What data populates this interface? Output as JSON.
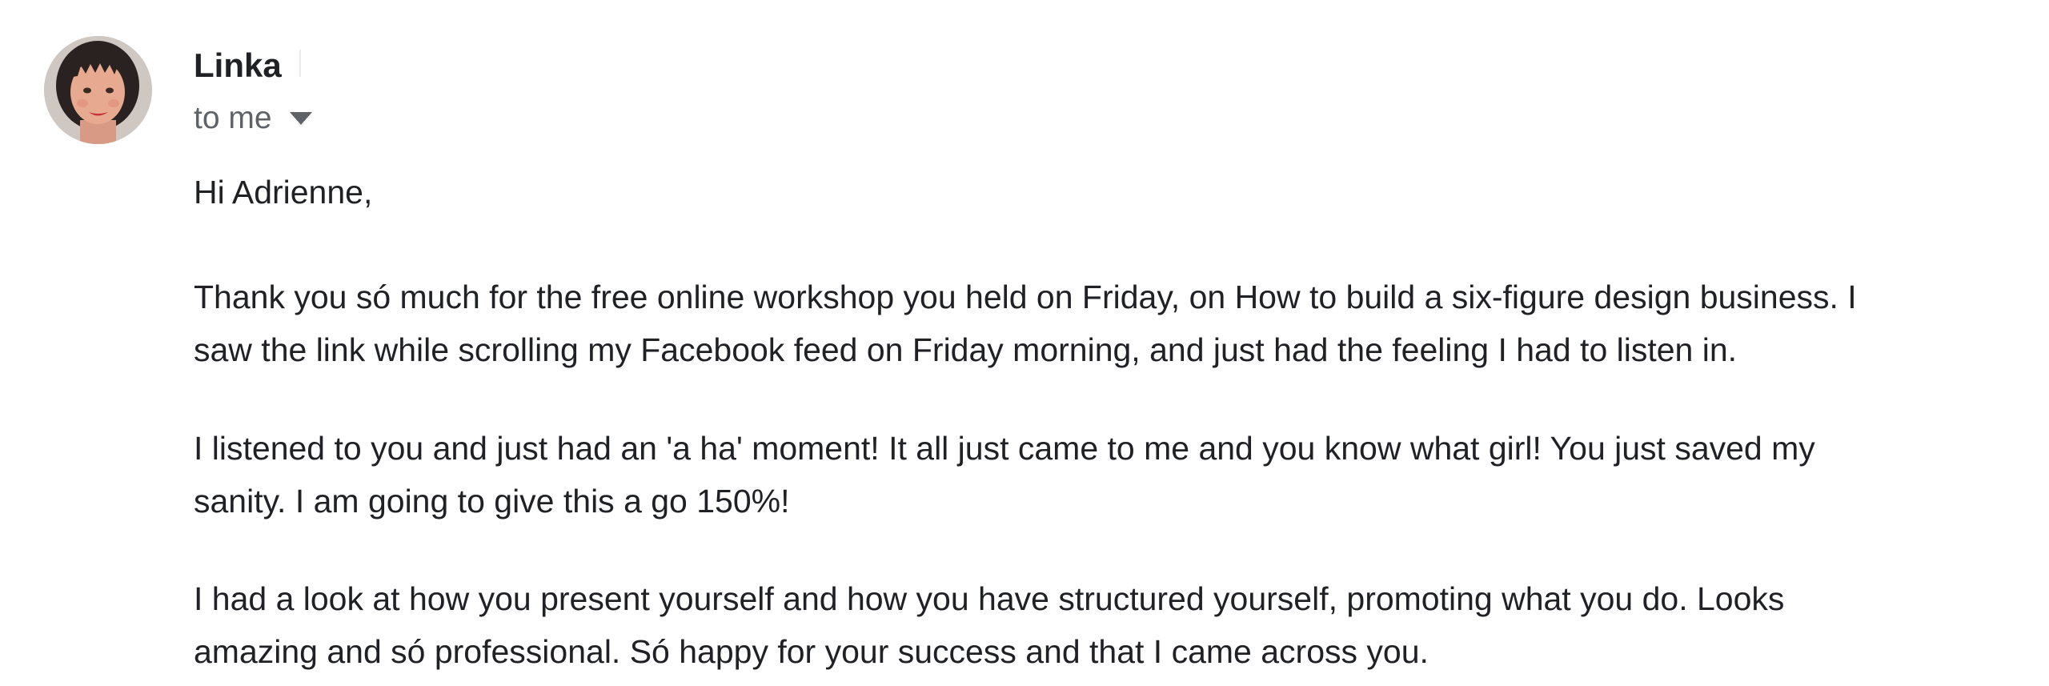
{
  "email": {
    "sender": {
      "name": "Linka",
      "avatar_icon": "user-photo-icon"
    },
    "recipient_label": "to me",
    "details_toggle_icon": "caret-down-icon",
    "body": {
      "greeting": "Hi Adrienne,",
      "paragraphs": [
        {
          "lines": [
            "Thank you só much for the free online workshop you held on Friday, on How to build a six-figure design business. I",
            "saw the link while scrolling my Facebook feed on Friday morning, and just had the feeling I had to listen in."
          ]
        },
        {
          "lines": [
            "I listened to you and just had an 'a ha' moment! It all just came to me and you know what girl! You just saved my",
            "sanity. I am going to give this a go 150%!"
          ]
        },
        {
          "lines": [
            "I had a look at how you present yourself and how you have structured yourself, promoting what you do. Looks",
            "amazing and só professional. Só happy for your success and that I came across you."
          ]
        }
      ]
    }
  },
  "colors": {
    "text_primary": "#202124",
    "text_secondary": "#5f6368",
    "background": "#ffffff"
  }
}
